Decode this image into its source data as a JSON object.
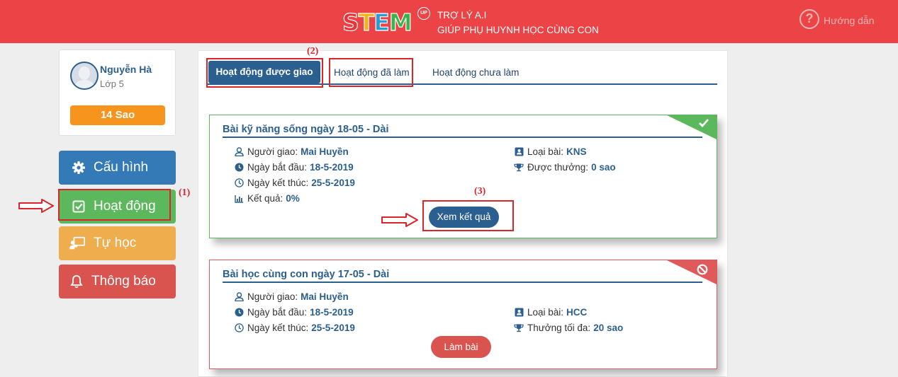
{
  "header": {
    "logo_letters": [
      {
        "ch": "S",
        "color": "#ec3237"
      },
      {
        "ch": "T",
        "color": "#f7b11b"
      },
      {
        "ch": "E",
        "color": "#2b9bd6"
      },
      {
        "ch": "M",
        "color": "#38b54a"
      }
    ],
    "logo_badge": "UP",
    "tagline_line1": "TRỢ LÝ A.I",
    "tagline_line2": "GIÚP PHỤ HUYNH HỌC CÙNG CON",
    "help_label": "Hướng dẫn"
  },
  "user": {
    "name": "Nguyễn Hà",
    "grade": "Lớp 5",
    "stars": "14 Sao"
  },
  "menu": {
    "config": "Cấu hình",
    "activity": "Hoạt động",
    "self_study": "Tự học",
    "notifications": "Thông báo"
  },
  "annotations": {
    "a1": "(1)",
    "a2": "(2)",
    "a3": "(3)"
  },
  "tabs": {
    "assigned": "Hoạt động được giao",
    "done": "Hoạt động đã làm",
    "not_done": "Hoạt động chưa làm"
  },
  "cards": [
    {
      "title": "Bài kỹ năng sống ngày 18-05 - Dài",
      "status_icon": "check-icon",
      "assigner_label": "Người giao:",
      "assigner": "Mai Huyền",
      "start_label": "Ngày bắt đầu:",
      "start": "18-5-2019",
      "end_label": "Ngày kết thúc:",
      "end": "25-5-2019",
      "result_label": "Kết quả:",
      "result": "0%",
      "type_label": "Loại bài:",
      "type": "KNS",
      "reward_label": "Được thưởng:",
      "reward": "0 sao",
      "button": "Xem kết quả"
    },
    {
      "title": "Bài học cùng con ngày 17-05 - Dài",
      "status_icon": "ban-icon",
      "assigner_label": "Người giao:",
      "assigner": "Mai Huyền",
      "start_label": "Ngày bắt đầu:",
      "start": "18-5-2019",
      "end_label": "Ngày kết thúc:",
      "end": "25-5-2019",
      "type_label": "Loại bài:",
      "type": "HCC",
      "reward_label": "Thưởng tối đa:",
      "reward": "20 sao",
      "button": "Làm bài"
    }
  ]
}
